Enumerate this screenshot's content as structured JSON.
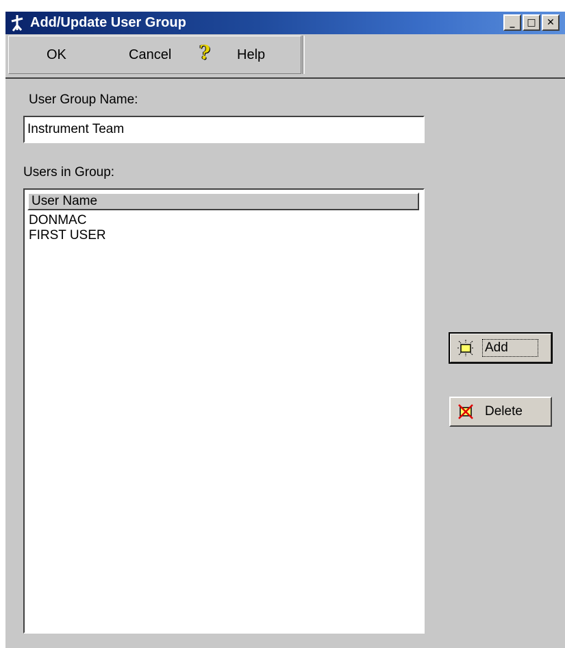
{
  "window": {
    "title": "Add/Update User Group",
    "controls": {
      "minimize": "_",
      "maximize": "□",
      "close": "✕"
    }
  },
  "toolbar": {
    "ok_label": "OK",
    "cancel_label": "Cancel",
    "help_label": "Help",
    "help_icon": "?"
  },
  "form": {
    "group_name_label": "User Group Name:",
    "group_name_value": "Instrument Team",
    "users_label": "Users in Group:",
    "list_header": "User Name",
    "users": [
      "DONMAC",
      "FIRST USER"
    ]
  },
  "actions": {
    "add_label": "Add",
    "delete_label": "Delete"
  },
  "colors": {
    "titlebar_start": "#0a246a",
    "titlebar_end": "#5b8fdc",
    "face": "#c8c8c8"
  }
}
